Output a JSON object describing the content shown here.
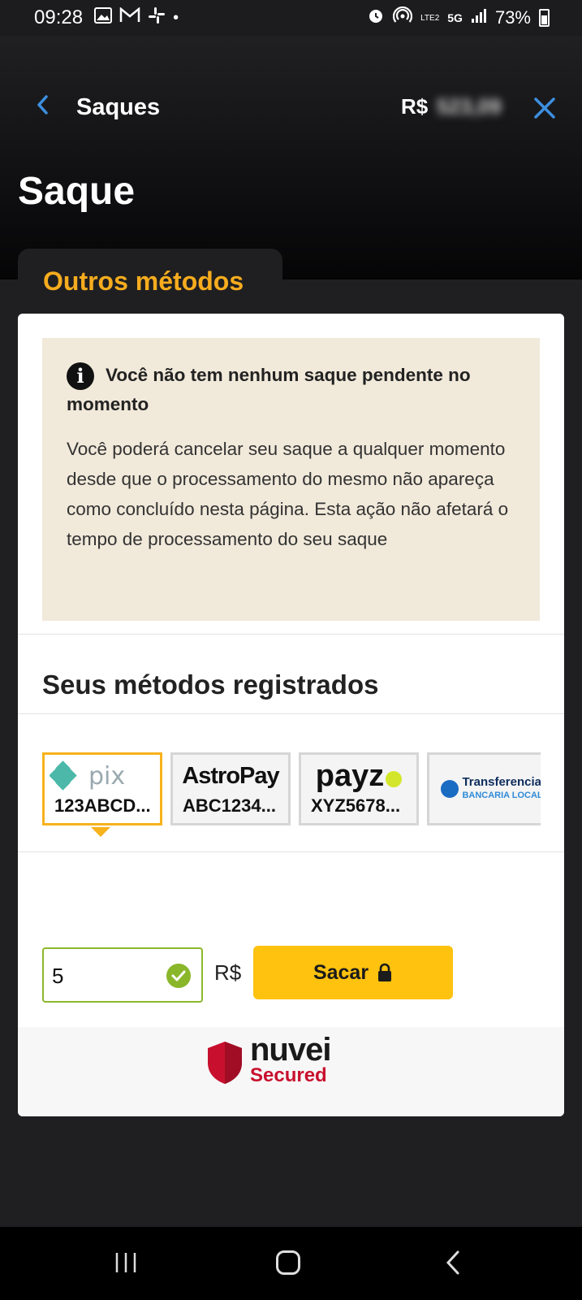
{
  "status_bar": {
    "time": "09:28",
    "battery": "73%",
    "network": "5G",
    "volte": "LTE2"
  },
  "header": {
    "nav_title": "Saques",
    "balance_currency": "R$",
    "balance_value": "523,09",
    "page_title": "Saque",
    "tab_label": "Outros métodos"
  },
  "notice": {
    "title": "Você não tem nenhum saque pendente no momento",
    "body": "Você poderá cancelar seu saque a qualquer momento desde que o processamento do mesmo não apareça como concluído nesta página. Esta ação não afetará o tempo de processamento do seu saque"
  },
  "methods": {
    "section_title": "Seus métodos registrados",
    "items": [
      {
        "logo": "pix",
        "id": "123ABCD...",
        "selected": true
      },
      {
        "logo": "AstroPay",
        "id": "ABC1234..."
      },
      {
        "logo": "payz",
        "id": "XYZ5678..."
      },
      {
        "logo_line1": "Transferencia",
        "logo_line2": "BANCARIA LOCAL"
      }
    ]
  },
  "withdraw": {
    "amount_value": "5",
    "currency": "R$",
    "button_label": "Sacar"
  },
  "secure": {
    "brand": "nuvei",
    "tagline": "Secured"
  },
  "colors": {
    "accent": "#f6ac1e",
    "button": "#fec20f",
    "notice_bg": "#f1e9da",
    "valid_green": "#8ab62a",
    "nuvei_red": "#c8102e"
  }
}
